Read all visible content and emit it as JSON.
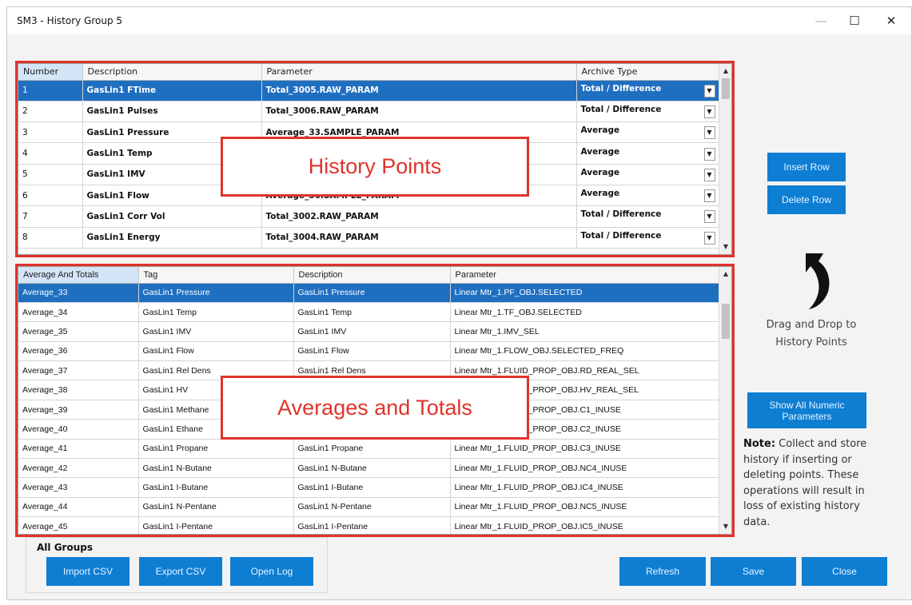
{
  "window": {
    "title": "SM3 - History Group 5",
    "controls": {
      "minimize": "—",
      "maximize": "☐",
      "close": "✕"
    }
  },
  "history_points": {
    "columns": [
      "Number",
      "Description",
      "Parameter",
      "Archive Type"
    ],
    "rows": [
      {
        "number": "1",
        "description": "GasLin1 FTime",
        "parameter": "Total_3005.RAW_PARAM",
        "archive": "Total / Difference",
        "selected": true
      },
      {
        "number": "2",
        "description": "GasLin1 Pulses",
        "parameter": "Total_3006.RAW_PARAM",
        "archive": "Total / Difference",
        "selected": false
      },
      {
        "number": "3",
        "description": "GasLin1 Pressure",
        "parameter": "Average_33.SAMPLE_PARAM",
        "archive": "Average",
        "selected": false
      },
      {
        "number": "4",
        "description": "GasLin1 Temp",
        "parameter": "",
        "archive": "Average",
        "selected": false
      },
      {
        "number": "5",
        "description": "GasLin1 IMV",
        "parameter": "",
        "archive": "Average",
        "selected": false
      },
      {
        "number": "6",
        "description": "GasLin1 Flow",
        "parameter": "Average_36.SAMPLE_PARAM",
        "archive": "Average",
        "selected": false
      },
      {
        "number": "7",
        "description": "GasLin1 Corr Vol",
        "parameter": "Total_3002.RAW_PARAM",
        "archive": "Total / Difference",
        "selected": false
      },
      {
        "number": "8",
        "description": "GasLin1 Energy",
        "parameter": "Total_3004.RAW_PARAM",
        "archive": "Total / Difference",
        "selected": false
      }
    ],
    "callout": "History Points"
  },
  "averages_totals": {
    "columns": [
      "Average And Totals",
      "Tag",
      "Description",
      "Parameter"
    ],
    "rows": [
      {
        "name": "Average_33",
        "tag": "GasLin1 Pressure",
        "description": "GasLin1 Pressure",
        "parameter": "Linear Mtr_1.PF_OBJ.SELECTED",
        "selected": true
      },
      {
        "name": "Average_34",
        "tag": "GasLin1 Temp",
        "description": "GasLin1 Temp",
        "parameter": "Linear Mtr_1.TF_OBJ.SELECTED",
        "selected": false
      },
      {
        "name": "Average_35",
        "tag": "GasLin1 IMV",
        "description": "GasLin1 IMV",
        "parameter": "Linear Mtr_1.IMV_SEL",
        "selected": false
      },
      {
        "name": "Average_36",
        "tag": "GasLin1 Flow",
        "description": "GasLin1 Flow",
        "parameter": "Linear Mtr_1.FLOW_OBJ.SELECTED_FREQ",
        "selected": false
      },
      {
        "name": "Average_37",
        "tag": "GasLin1 Rel Dens",
        "description": "GasLin1 Rel Dens",
        "parameter": "Linear Mtr_1.FLUID_PROP_OBJ.RD_REAL_SEL",
        "selected": false
      },
      {
        "name": "Average_38",
        "tag": "GasLin1 HV",
        "description": "",
        "parameter": "Linear Mtr_1.FLUID_PROP_OBJ.HV_REAL_SEL",
        "selected": false
      },
      {
        "name": "Average_39",
        "tag": "GasLin1 Methane",
        "description": "",
        "parameter": "Linear Mtr_1.FLUID_PROP_OBJ.C1_INUSE",
        "selected": false
      },
      {
        "name": "Average_40",
        "tag": "GasLin1 Ethane",
        "description": "",
        "parameter": "Linear Mtr_1.FLUID_PROP_OBJ.C2_INUSE",
        "selected": false
      },
      {
        "name": "Average_41",
        "tag": "GasLin1 Propane",
        "description": "GasLin1 Propane",
        "parameter": "Linear Mtr_1.FLUID_PROP_OBJ.C3_INUSE",
        "selected": false
      },
      {
        "name": "Average_42",
        "tag": "GasLin1 N-Butane",
        "description": "GasLin1 N-Butane",
        "parameter": "Linear Mtr_1.FLUID_PROP_OBJ.NC4_INUSE",
        "selected": false
      },
      {
        "name": "Average_43",
        "tag": "GasLin1 I-Butane",
        "description": "GasLin1 I-Butane",
        "parameter": "Linear Mtr_1.FLUID_PROP_OBJ.IC4_INUSE",
        "selected": false
      },
      {
        "name": "Average_44",
        "tag": "GasLin1 N-Pentane",
        "description": "GasLin1 N-Pentane",
        "parameter": "Linear Mtr_1.FLUID_PROP_OBJ.NC5_INUSE",
        "selected": false
      },
      {
        "name": "Average_45",
        "tag": "GasLin1 I-Pentane",
        "description": "GasLin1 I-Pentane",
        "parameter": "Linear Mtr_1.FLUID_PROP_OBJ.IC5_INUSE",
        "selected": false
      }
    ],
    "callout": "Averages and Totals"
  },
  "side": {
    "insert_row": "Insert Row",
    "delete_row": "Delete Row",
    "drag_text_1": "Drag and Drop to",
    "drag_text_2": "History Points",
    "show_all": "Show All Numeric Parameters",
    "note_label": "Note:",
    "note_text": " Collect and store history if inserting or deleting points. These operations will result in loss of existing history data."
  },
  "bottom": {
    "group_label": "All Groups",
    "import_csv": "Import CSV",
    "export_csv": "Export CSV",
    "open_log": "Open Log",
    "refresh": "Refresh",
    "save": "Save",
    "close": "Close"
  },
  "colors": {
    "accent_blue": "#0e7ed3",
    "selection_blue": "#1f6fc1",
    "highlight_red": "#e0332a"
  }
}
